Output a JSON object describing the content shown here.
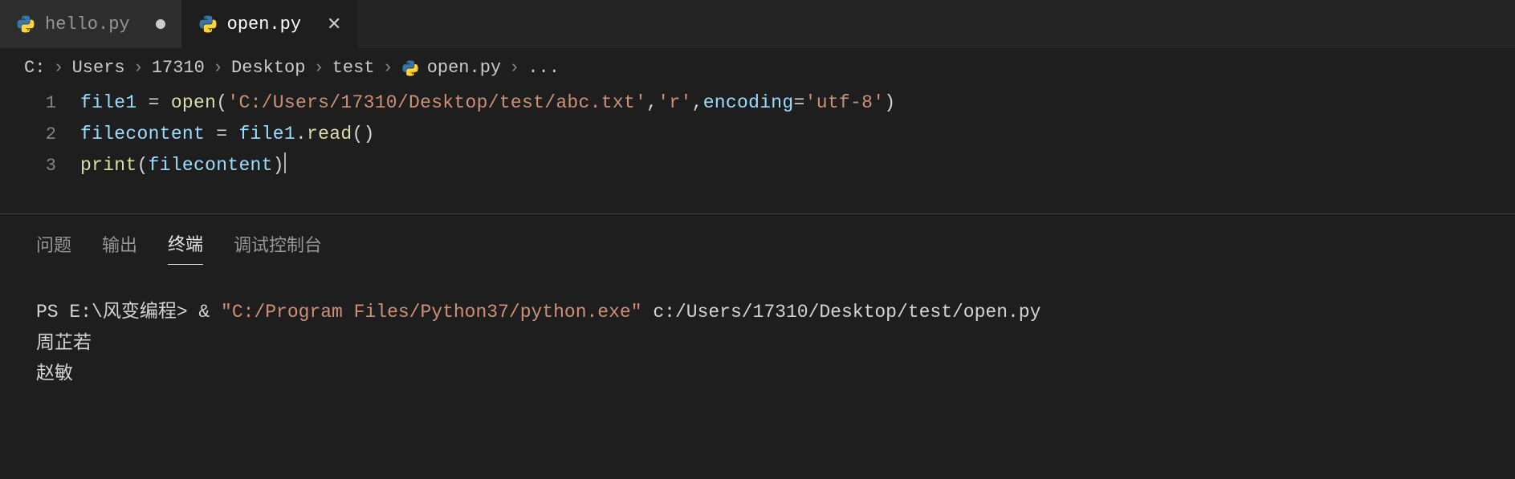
{
  "tabs": [
    {
      "label": "hello.py",
      "active": false,
      "dirty": true
    },
    {
      "label": "open.py",
      "active": true,
      "dirty": false
    }
  ],
  "breadcrumb": {
    "parts": [
      "C:",
      "Users",
      "17310",
      "Desktop",
      "test"
    ],
    "file": "open.py",
    "tail": "..."
  },
  "code_lines": [
    {
      "n": "1",
      "tokens": [
        {
          "c": "tk-var",
          "t": "file1"
        },
        {
          "c": "tk-op",
          "t": " = "
        },
        {
          "c": "tk-fn",
          "t": "open"
        },
        {
          "c": "tk-op",
          "t": "("
        },
        {
          "c": "tk-str",
          "t": "'C:/Users/17310/Desktop/test/abc.txt'"
        },
        {
          "c": "tk-op",
          "t": ","
        },
        {
          "c": "tk-str",
          "t": "'r'"
        },
        {
          "c": "tk-op",
          "t": ","
        },
        {
          "c": "tk-param",
          "t": "encoding"
        },
        {
          "c": "tk-op",
          "t": "="
        },
        {
          "c": "tk-str",
          "t": "'utf-8'"
        },
        {
          "c": "tk-op",
          "t": ")"
        }
      ]
    },
    {
      "n": "2",
      "tokens": [
        {
          "c": "tk-var",
          "t": "filecontent"
        },
        {
          "c": "tk-op",
          "t": " = "
        },
        {
          "c": "tk-var",
          "t": "file1"
        },
        {
          "c": "tk-op",
          "t": "."
        },
        {
          "c": "tk-fn",
          "t": "read"
        },
        {
          "c": "tk-op",
          "t": "()"
        }
      ]
    },
    {
      "n": "3",
      "tokens": [
        {
          "c": "tk-fn",
          "t": "print"
        },
        {
          "c": "tk-op",
          "t": "("
        },
        {
          "c": "tk-var",
          "t": "filecontent"
        },
        {
          "c": "tk-op",
          "t": ")"
        }
      ],
      "cursor_after": true
    }
  ],
  "panel_tabs": {
    "problems": "问题",
    "output": "输出",
    "terminal": "终端",
    "debug_console": "调试控制台"
  },
  "terminal": {
    "prompt_prefix": "PS ",
    "prompt_path": "E:\\风变编程",
    "prompt_suffix": "> ",
    "amp": "& ",
    "exe_path": "\"C:/Program Files/Python37/python.exe\"",
    "script_arg": " c:/Users/17310/Desktop/test/open.py",
    "output_lines": [
      "周芷若",
      "赵敏"
    ]
  }
}
